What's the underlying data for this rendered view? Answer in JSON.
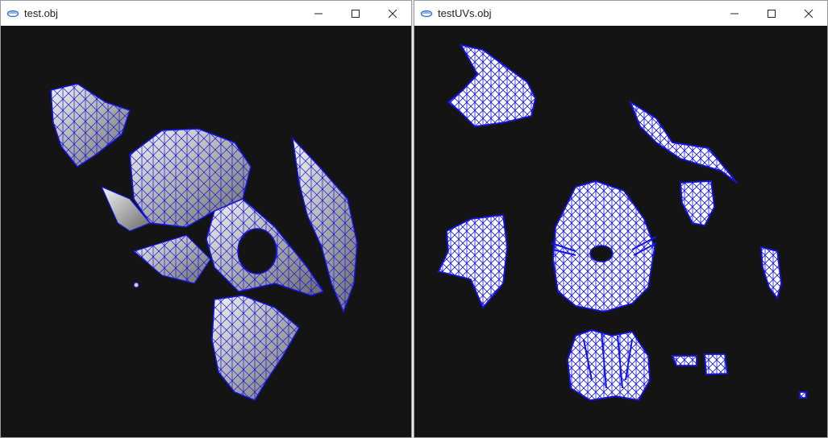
{
  "windows": [
    {
      "title": "test.obj",
      "controls": {
        "minimize_icon": "minimize-icon",
        "maximize_icon": "maximize-icon",
        "close_icon": "close-icon"
      }
    },
    {
      "title": "testUVs.obj",
      "controls": {
        "minimize_icon": "minimize-icon",
        "maximize_icon": "maximize-icon",
        "close_icon": "close-icon"
      }
    }
  ],
  "colors": {
    "viewport_bg": "#141414",
    "wireframe": "#1414e6",
    "surface": "#d8d8d8",
    "titlebar_bg": "#ffffff"
  }
}
